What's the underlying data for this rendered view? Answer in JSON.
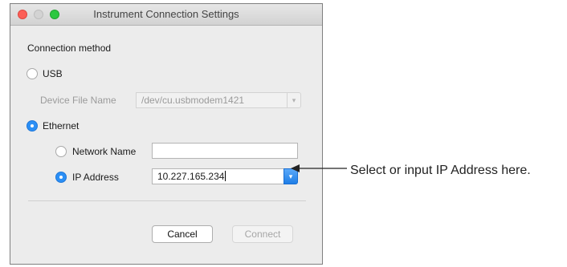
{
  "window": {
    "title": "Instrument Connection Settings"
  },
  "form": {
    "section_label": "Connection method",
    "usb": {
      "label": "USB",
      "selected": false,
      "device_file_label": "Device File Name",
      "device_file_value": "/dev/cu.usbmodem1421"
    },
    "ethernet": {
      "label": "Ethernet",
      "selected": true,
      "network_name_label": "Network Name",
      "network_name_value": "",
      "network_name_selected": false,
      "ip_address_label": "IP Address",
      "ip_address_value": "10.227.165.234",
      "ip_address_selected": true
    }
  },
  "buttons": {
    "cancel_label": "Cancel",
    "connect_label": "Connect"
  },
  "annotation": {
    "text": "Select or input IP Address here."
  },
  "colors": {
    "accent": "#2b8ff5",
    "close": "#fc5f57",
    "maximize": "#2cc840"
  }
}
